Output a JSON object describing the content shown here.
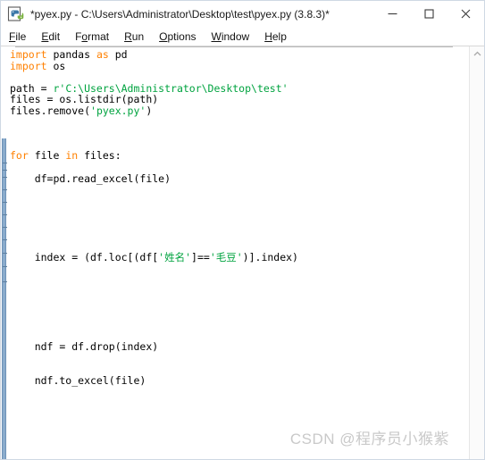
{
  "window": {
    "title": "*pyex.py - C:\\Users\\Administrator\\Desktop\\test\\pyex.py (3.8.3)*",
    "app_icon": "python-idle-icon",
    "controls": {
      "minimize": "minimize-icon",
      "maximize": "maximize-icon",
      "close": "close-icon"
    }
  },
  "menubar": {
    "items": [
      {
        "label": "File",
        "mnemonic": "F",
        "rest": "ile"
      },
      {
        "label": "Edit",
        "mnemonic": "E",
        "rest": "dit"
      },
      {
        "label": "Format",
        "mnemonic": "o",
        "pre": "F",
        "rest": "rmat"
      },
      {
        "label": "Run",
        "mnemonic": "R",
        "rest": "un"
      },
      {
        "label": "Options",
        "mnemonic": "O",
        "rest": "ptions"
      },
      {
        "label": "Window",
        "mnemonic": "W",
        "rest": "indow"
      },
      {
        "label": "Help",
        "mnemonic": "H",
        "rest": "elp"
      }
    ]
  },
  "editor": {
    "language": "python",
    "colors": {
      "keyword": "#ff8000",
      "string": "#00a33f",
      "text": "#000000",
      "background": "#ffffff",
      "guide_bar": "#8aabcc"
    },
    "lines": [
      {
        "n": 1,
        "tokens": [
          {
            "t": "import",
            "c": "kw"
          },
          {
            "t": " pandas ",
            "c": "pl"
          },
          {
            "t": "as",
            "c": "kw"
          },
          {
            "t": " pd",
            "c": "pl"
          }
        ]
      },
      {
        "n": 2,
        "tokens": [
          {
            "t": "import",
            "c": "kw"
          },
          {
            "t": " os",
            "c": "pl"
          }
        ]
      },
      {
        "n": 3,
        "tokens": []
      },
      {
        "n": 4,
        "tokens": [
          {
            "t": "path = ",
            "c": "pl"
          },
          {
            "t": "r'C:\\Users\\Administrator\\Desktop\\test'",
            "c": "str"
          }
        ]
      },
      {
        "n": 5,
        "tokens": [
          {
            "t": "files = os.listdir(path)",
            "c": "pl"
          }
        ]
      },
      {
        "n": 6,
        "tokens": [
          {
            "t": "files.remove(",
            "c": "pl"
          },
          {
            "t": "'pyex.py'",
            "c": "str"
          },
          {
            "t": ")",
            "c": "pl"
          }
        ]
      },
      {
        "n": 7,
        "tokens": []
      },
      {
        "n": 8,
        "tokens": []
      },
      {
        "n": 9,
        "tokens": []
      },
      {
        "n": 10,
        "tokens": [
          {
            "t": "for",
            "c": "kw"
          },
          {
            "t": " file ",
            "c": "pl"
          },
          {
            "t": "in",
            "c": "kw"
          },
          {
            "t": " files:",
            "c": "pl"
          }
        ]
      },
      {
        "n": 11,
        "tokens": []
      },
      {
        "n": 12,
        "tokens": [
          {
            "t": "    df=pd.read_excel(file)",
            "c": "pl"
          }
        ]
      },
      {
        "n": 13,
        "tokens": []
      },
      {
        "n": 14,
        "tokens": []
      },
      {
        "n": 15,
        "tokens": []
      },
      {
        "n": 16,
        "tokens": []
      },
      {
        "n": 17,
        "tokens": []
      },
      {
        "n": 18,
        "tokens": []
      },
      {
        "n": 19,
        "tokens": [
          {
            "t": "    index = (df.loc[(df[",
            "c": "pl"
          },
          {
            "t": "'姓名'",
            "c": "str"
          },
          {
            "t": "]==",
            "c": "pl"
          },
          {
            "t": "'毛豆'",
            "c": "str"
          },
          {
            "t": ")].index)",
            "c": "pl"
          }
        ]
      },
      {
        "n": 20,
        "tokens": []
      },
      {
        "n": 21,
        "tokens": []
      },
      {
        "n": 22,
        "tokens": []
      },
      {
        "n": 23,
        "tokens": []
      },
      {
        "n": 24,
        "tokens": []
      },
      {
        "n": 25,
        "tokens": []
      },
      {
        "n": 26,
        "tokens": []
      },
      {
        "n": 27,
        "tokens": [
          {
            "t": "    ndf = df.drop(index)",
            "c": "pl"
          }
        ]
      },
      {
        "n": 28,
        "tokens": []
      },
      {
        "n": 29,
        "tokens": []
      },
      {
        "n": 30,
        "tokens": [
          {
            "t": "    ndf.to_excel(file)",
            "c": "pl"
          }
        ]
      }
    ]
  },
  "scrollbar": {
    "up_arrow": "chevron-up-icon"
  },
  "watermark": {
    "text": "CSDN @程序员小猴紫"
  }
}
